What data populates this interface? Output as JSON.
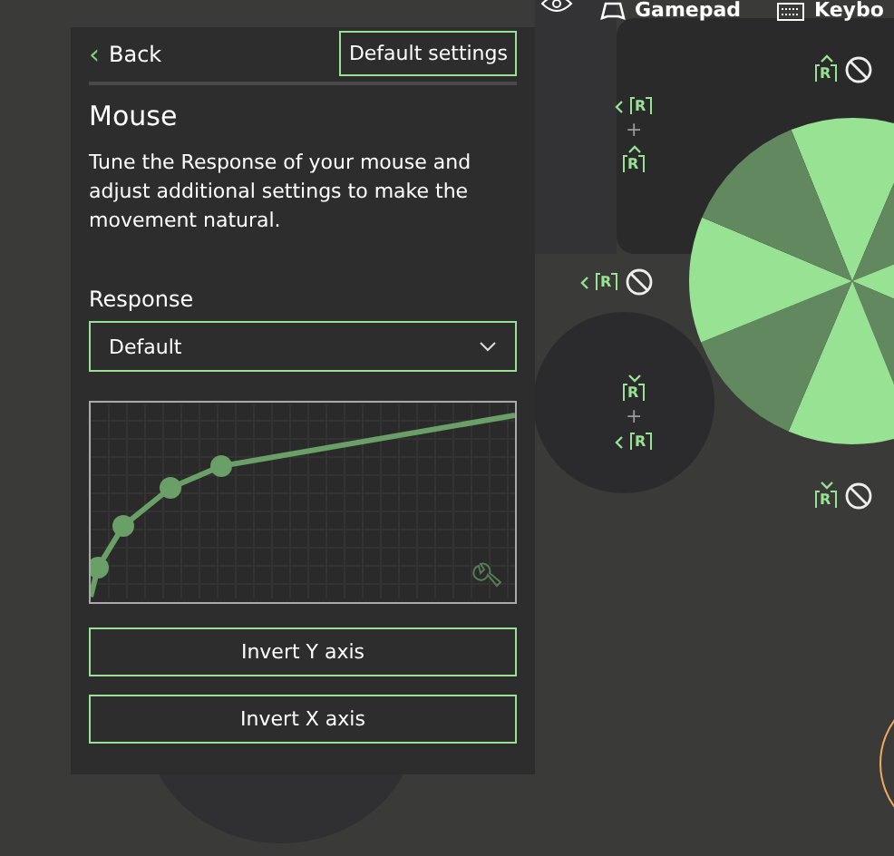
{
  "top_tabs": [
    {
      "kind": "gamepad",
      "label": "Gamepad"
    },
    {
      "kind": "keyboard",
      "label": "Keybo"
    }
  ],
  "panel": {
    "back": {
      "glyph": "‹",
      "label": "Back"
    },
    "reset_button": "Default settings",
    "title": "Mouse",
    "description": "Tune the Response of your mouse and adjust additional settings to make the movement natural.",
    "response": {
      "label": "Response",
      "value": "Default"
    },
    "buttons": [
      "Invert Y axis",
      "Invert X axis"
    ]
  },
  "bindings": [
    {
      "kind": "unbound",
      "inputs": [
        {
          "kind": "up",
          "key": "R"
        }
      ]
    },
    {
      "kind": "combo",
      "inputs": [
        {
          "kind": "left",
          "key": "R"
        },
        {
          "kind": "up",
          "key": "R"
        }
      ],
      "joiner": "+"
    },
    {
      "kind": "unbound",
      "inputs": [
        {
          "kind": "left",
          "key": "R"
        }
      ]
    },
    {
      "kind": "combo",
      "inputs": [
        {
          "kind": "down",
          "key": "R"
        },
        {
          "kind": "left",
          "key": "R"
        }
      ],
      "joiner": "+"
    },
    {
      "kind": "unbound",
      "inputs": [
        {
          "kind": "down",
          "key": "R"
        }
      ]
    }
  ]
}
